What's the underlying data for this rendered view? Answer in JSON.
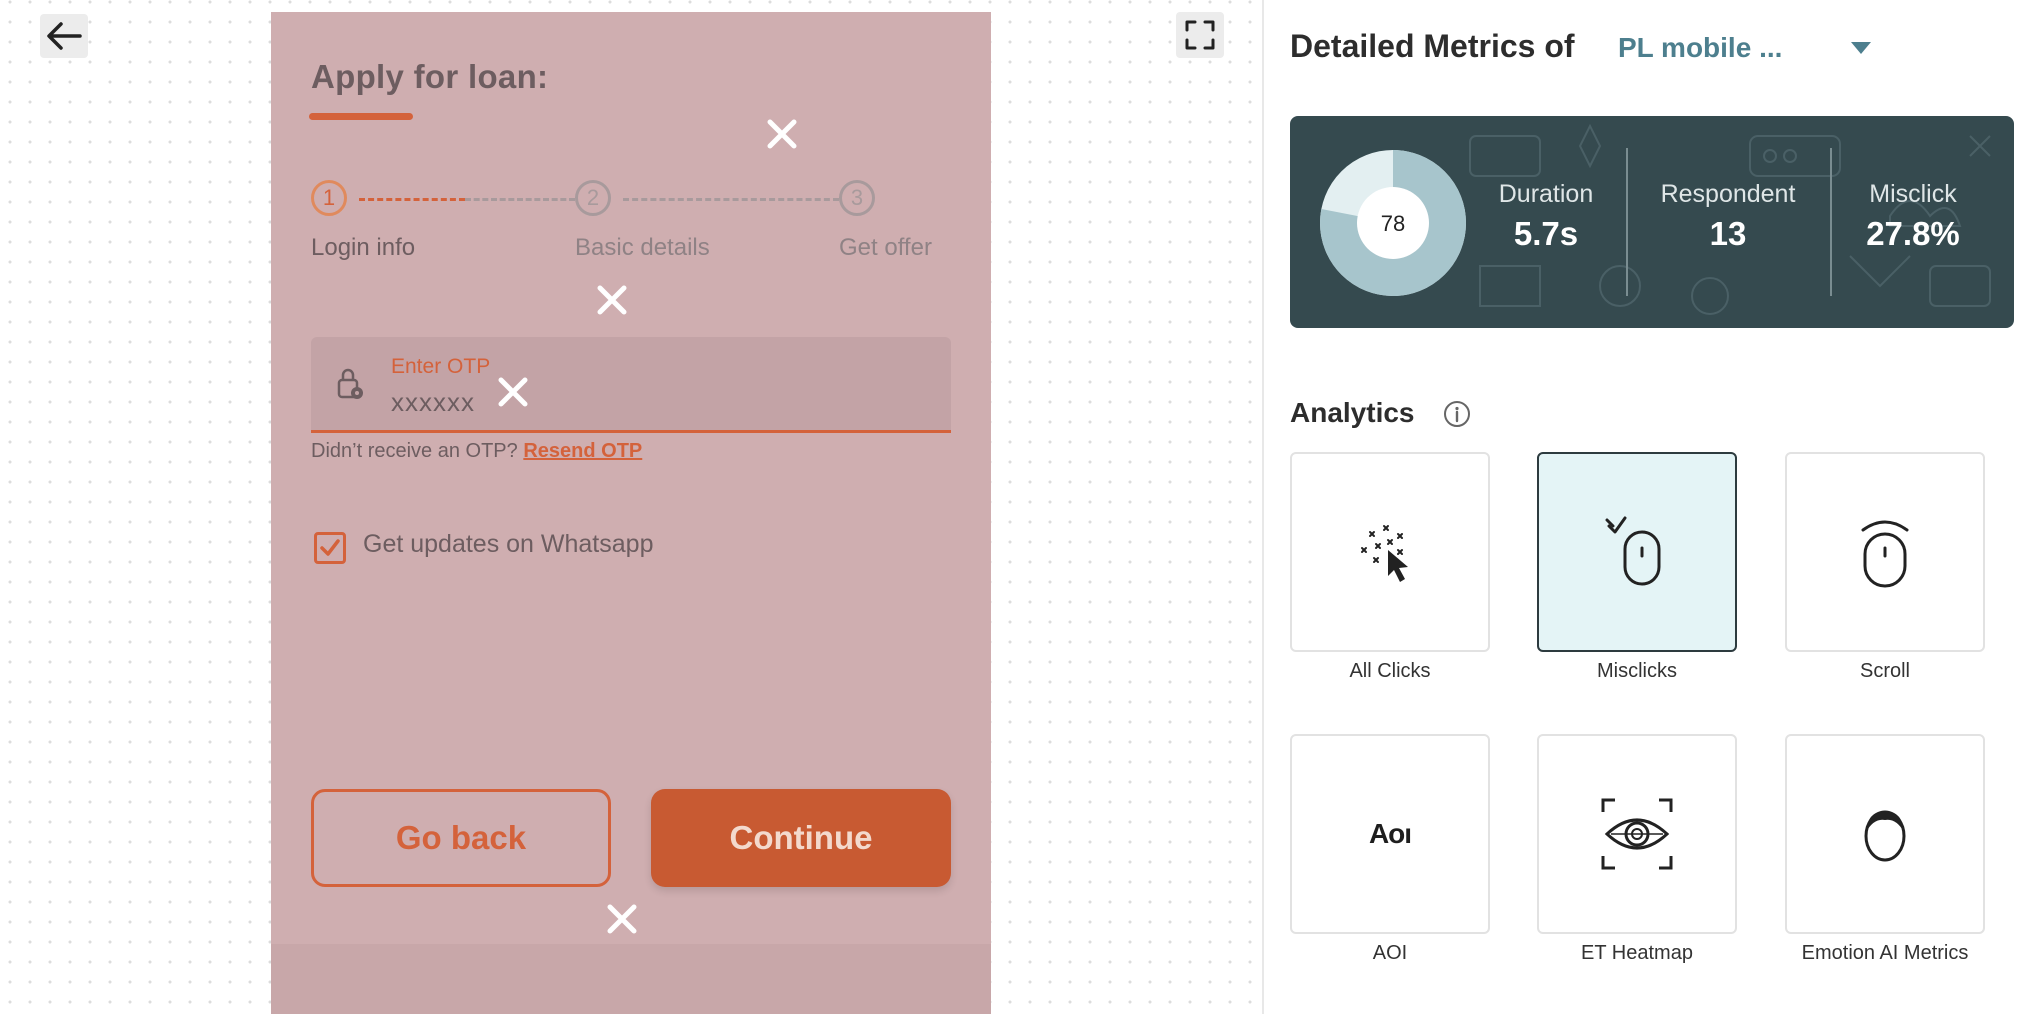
{
  "nav": {
    "back_icon": "arrow-left-icon",
    "expand_icon": "fullscreen-icon"
  },
  "phone": {
    "title": "Apply for loan:",
    "steps": [
      {
        "number": "1",
        "label": "Login info",
        "active": true
      },
      {
        "number": "2",
        "label": "Basic details",
        "active": false
      },
      {
        "number": "3",
        "label": "Get offer",
        "active": false
      }
    ],
    "otp": {
      "label": "Enter OTP",
      "value": "xxxxxx"
    },
    "otp_help": "Didn’t receive an OTP?",
    "resend_label": "Resend OTP",
    "whatsapp_label": "Get updates on Whatsapp",
    "whatsapp_checked": true,
    "go_back_label": "Go back",
    "continue_label": "Continue",
    "misclick_marker_icon": "close-icon",
    "colors": {
      "overlay": "#cfaeb0",
      "accent": "#d4623b"
    }
  },
  "metrics": {
    "title": "Detailed Metrics of",
    "project": "PL mobile ...",
    "score": "78",
    "score_fraction": 0.78,
    "stats": [
      {
        "label": "Duration",
        "value": "5.7s"
      },
      {
        "label": "Respondent",
        "value": "13"
      },
      {
        "label": "Misclick",
        "value": "27.8%"
      }
    ],
    "card_color": "#354a4f"
  },
  "analytics": {
    "title": "Analytics",
    "tiles": [
      {
        "label": "All Clicks",
        "icon": "clicks-icon",
        "selected": false
      },
      {
        "label": "Misclicks",
        "icon": "misclick-mouse-icon",
        "selected": true
      },
      {
        "label": "Scroll",
        "icon": "scroll-mouse-icon",
        "selected": false
      },
      {
        "label": "AOI",
        "icon": "aoi-icon",
        "icon_text": "Aoı",
        "selected": false
      },
      {
        "label": "ET Heatmap",
        "icon": "eye-tracking-icon",
        "selected": false
      },
      {
        "label": "Emotion AI Metrics",
        "icon": "face-icon",
        "selected": false
      }
    ]
  }
}
